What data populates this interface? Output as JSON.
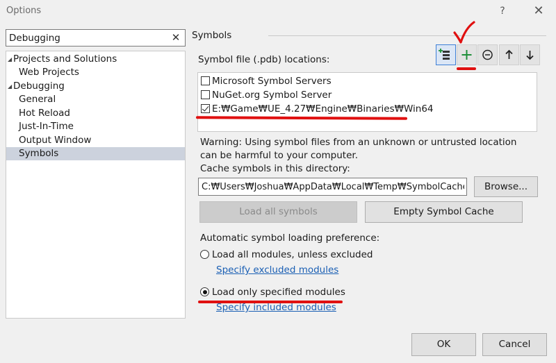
{
  "window": {
    "title": "Options",
    "help_glyph": "?",
    "close_glyph": "✕"
  },
  "search": {
    "value": "Debugging",
    "clear_glyph": "✕"
  },
  "tree": {
    "items": [
      {
        "label": "Projects and Solutions",
        "level": 0,
        "expanded": true
      },
      {
        "label": "Web Projects",
        "level": 1
      },
      {
        "label": "Debugging",
        "level": 0,
        "expanded": true
      },
      {
        "label": "General",
        "level": 1
      },
      {
        "label": "Hot Reload",
        "level": 1
      },
      {
        "label": "Just-In-Time",
        "level": 1
      },
      {
        "label": "Output Window",
        "level": 1
      },
      {
        "label": "Symbols",
        "level": 1,
        "selected": true
      }
    ]
  },
  "symbols": {
    "heading": "Symbols",
    "locations_label": "Symbol file (.pdb) locations:",
    "toolbar": [
      "load-symbols-icon",
      "add-icon",
      "remove-icon",
      "arrow-up-icon",
      "arrow-down-icon"
    ],
    "locations": [
      {
        "label": "Microsoft Symbol Servers",
        "checked": false
      },
      {
        "label": "NuGet.org Symbol Server",
        "checked": false
      },
      {
        "label": "E:₩Game₩UE_4.27₩Engine₩Binaries₩Win64",
        "checked": true
      }
    ],
    "warning": "Warning: Using symbol files from an unknown or untrusted location can be harmful to your computer.",
    "cache_label": "Cache symbols in this directory:",
    "cache_path": "C:₩Users₩Joshua₩AppData₩Local₩Temp₩SymbolCache",
    "browse_label": "Browse...",
    "load_all_label": "Load all symbols",
    "empty_cache_label": "Empty Symbol Cache",
    "auto_label": "Automatic symbol loading preference:",
    "radio_all": {
      "label": "Load all modules, unless excluded",
      "checked": false
    },
    "link_excluded": "Specify excluded modules",
    "radio_specified": {
      "label": "Load only specified modules",
      "checked": true
    },
    "link_included": "Specify included modules"
  },
  "footer": {
    "ok_label": "OK",
    "cancel_label": "Cancel"
  },
  "colors": {
    "accent": "#3d7fd6",
    "annotation": "#e01010",
    "add_green": "#1f8f3a",
    "link": "#1a5fb4"
  }
}
